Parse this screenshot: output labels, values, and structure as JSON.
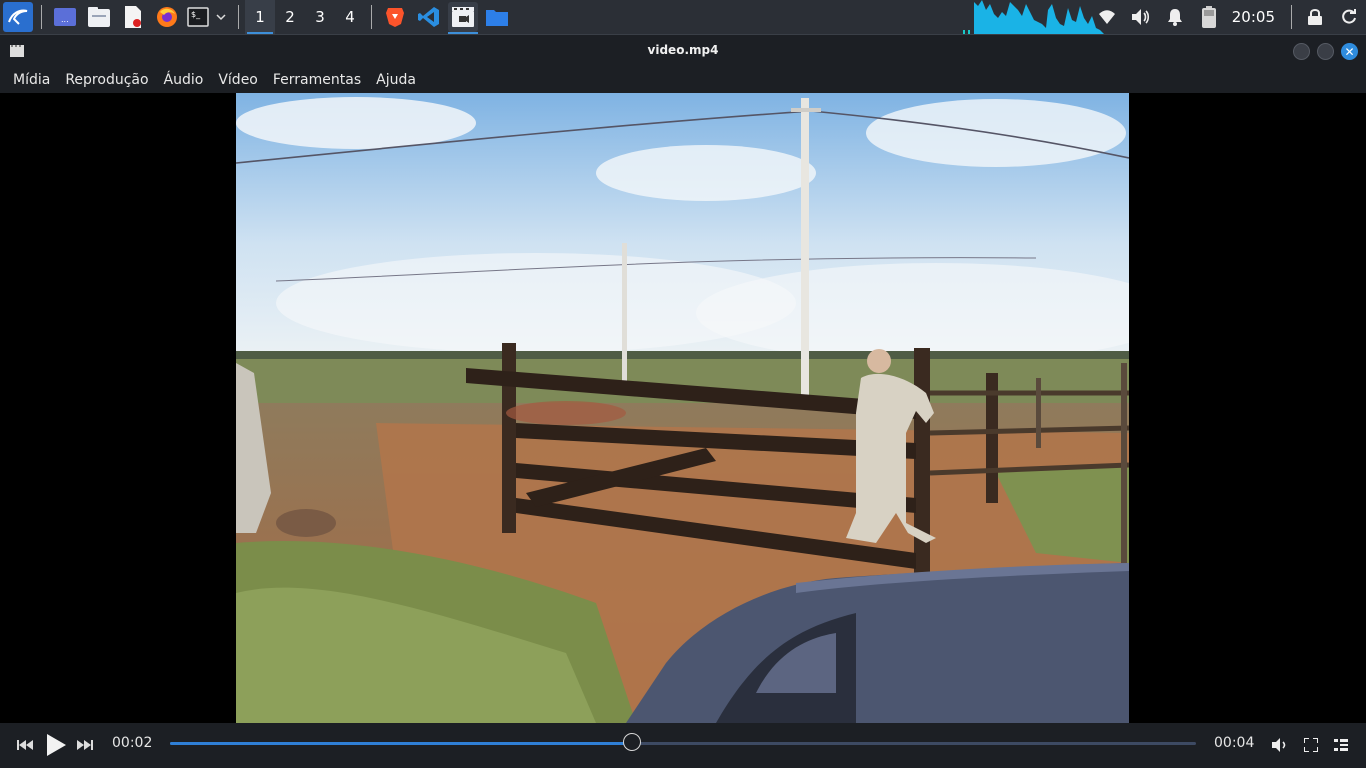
{
  "taskbar": {
    "workspaces": [
      "1",
      "2",
      "3",
      "4"
    ],
    "active_workspace": 0,
    "clock": "20:05",
    "apps": [
      "kali-menu-icon",
      "desktop-icon",
      "file-manager-icon",
      "text-editor-icon",
      "firefox-icon",
      "terminal-icon",
      "brave-icon",
      "vscode-icon",
      "video-player-icon",
      "folder-icon"
    ],
    "tray": [
      "wifi-icon",
      "volume-icon",
      "notification-icon",
      "battery-icon",
      "lock-icon",
      "refresh-icon"
    ]
  },
  "window": {
    "title": "video.mp4",
    "menu": [
      "Mídia",
      "Reprodução",
      "Áudio",
      "Vídeo",
      "Ferramentas",
      "Ajuda"
    ]
  },
  "player": {
    "current_time": "00:02",
    "total_time": "00:04",
    "progress": 0.45
  },
  "colors": {
    "accent": "#2f8cdd",
    "taskbar_bg": "#2b2f36",
    "window_bg": "#1c1f24"
  }
}
